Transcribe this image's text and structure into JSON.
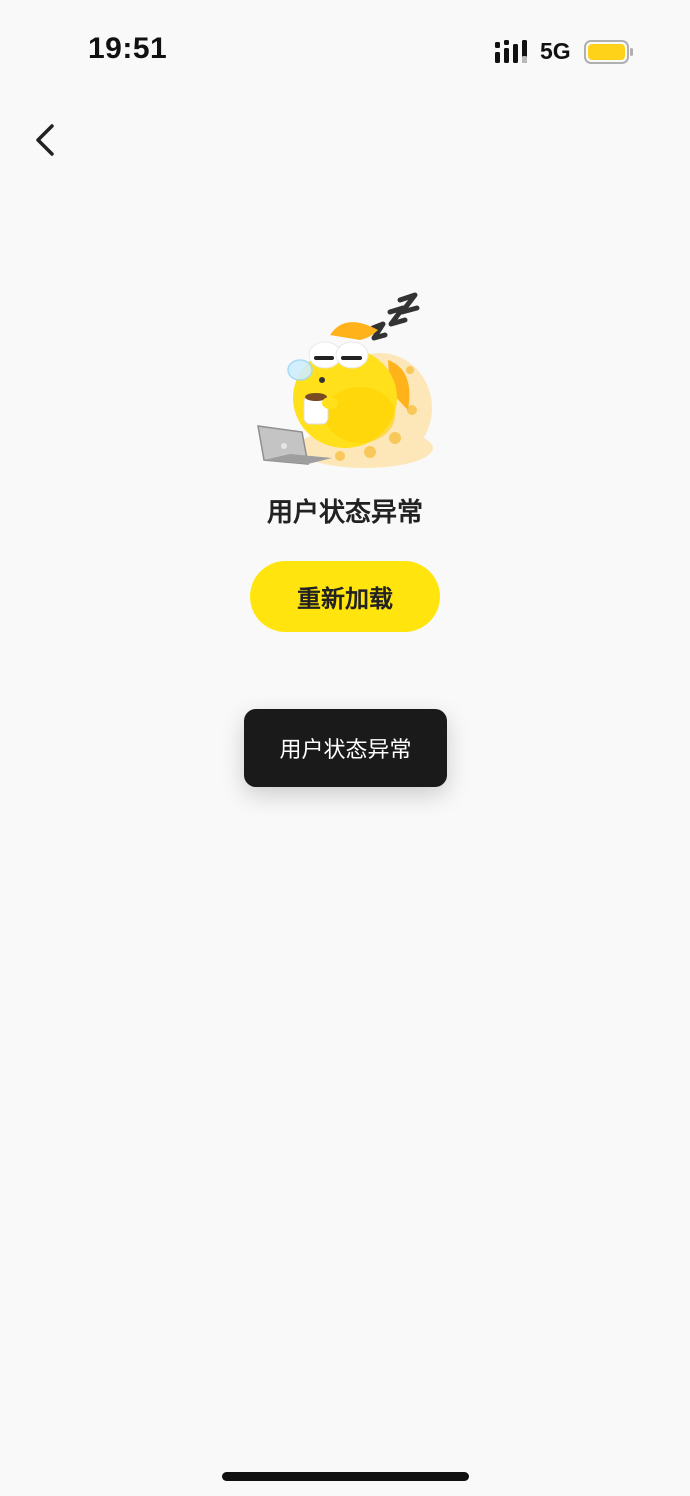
{
  "status_bar": {
    "time": "19:51",
    "network": "5G",
    "signal_icon": "cellular-signal-icon",
    "battery_icon": "battery-icon",
    "battery_color": "#ffd21a"
  },
  "nav": {
    "back_icon": "chevron-left-icon"
  },
  "error_state": {
    "illustration": "sleeping-fish-mascot",
    "title": "用户状态异常",
    "reload_label": "重新加载",
    "accent_color": "#ffe50d"
  },
  "toast": {
    "message": "用户状态异常"
  }
}
